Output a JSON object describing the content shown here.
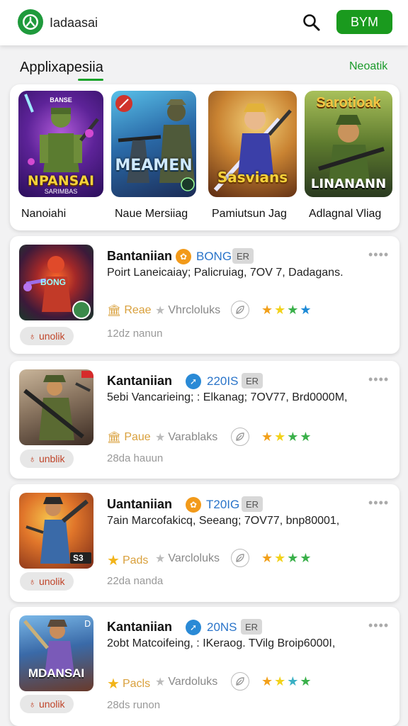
{
  "header": {
    "app_name": "Iadaasai",
    "buy_label": "BYM"
  },
  "section": {
    "title": "Applixapesiia",
    "link": "Neoatik"
  },
  "featured": [
    {
      "label": "Nanoiahi",
      "art_title": "NPANSAI",
      "art_sub": "SARIMBAS",
      "art_top": "BANSE"
    },
    {
      "label": "Naue Mersiiag",
      "art_title": "MEAMEN",
      "art_sub": "",
      "art_top": ""
    },
    {
      "label": "Pamiutsun Jag",
      "art_title": "Sasvians",
      "art_sub": "",
      "art_top": ""
    },
    {
      "label": "Adlagnal Vliag",
      "art_title": "LINANANN",
      "art_sub": "",
      "art_top": "Sarotioak"
    }
  ],
  "cards": [
    {
      "title": "Bantaniian",
      "version": "BONG",
      "er": "ER",
      "desc": "Poirt Laneicaiay; Palicruiag, 7OV 7, Dadagans.",
      "meta1": "Reae",
      "meta2": "Vhrcloluks",
      "unlock": "unolik",
      "duration": "12dz nanun",
      "thumb_text": "BONG"
    },
    {
      "title": "Kantaniian",
      "version": "220IS",
      "er": "ER",
      "desc": "5ebi Vancarieing; : Elkanag; 7OV77, Brd0000M,",
      "meta1": "Paue",
      "meta2": "Varablaks",
      "unlock": "unblik",
      "duration": "28da hauun",
      "thumb_text": ""
    },
    {
      "title": "Uantaniian",
      "version": "T20IG",
      "er": "ER",
      "desc": "7ain Marcofakicq, Seeang; 7OV77, bnp80001,",
      "meta1": "Pads",
      "meta2": "Varcloluks",
      "unlock": "unolik",
      "duration": "22da nanda",
      "thumb_text": "S3"
    },
    {
      "title": "Kantaniian",
      "version": "20NS",
      "er": "ER",
      "desc": "2obt Matcoifeing, : IKeraog. TVilg Broip6000I,",
      "meta1": "Pacls",
      "meta2": "Vardoluks",
      "unlock": "unolik",
      "duration": "28ds runon",
      "thumb_text": "MDANSAI"
    }
  ],
  "icons": {
    "logo": "leaf-logo-icon",
    "search": "search-icon",
    "more": "more-dots-icon",
    "leaf": "leaf-icon",
    "lock": "lock-icon",
    "star": "star-icon",
    "gift": "gift-icon"
  },
  "colors": {
    "accent": "#1a9a1e",
    "link": "#1a9a2a",
    "version": "#2a74c9"
  }
}
